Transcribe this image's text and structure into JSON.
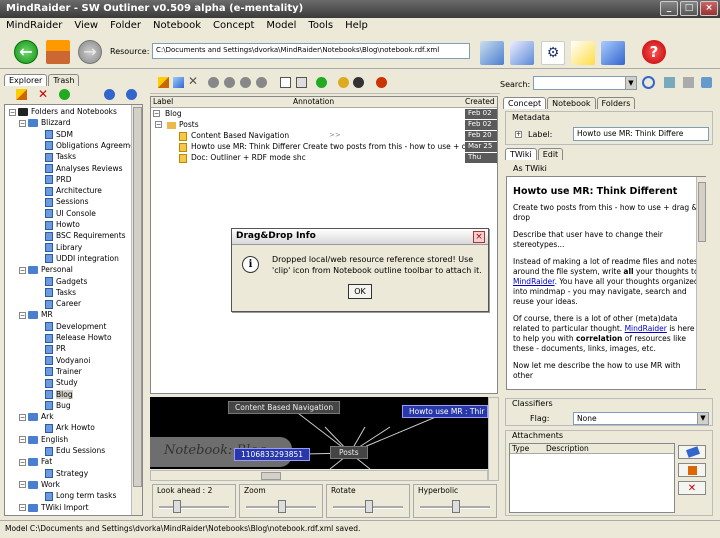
{
  "window": {
    "title": "MindRaider - SW Outliner v0.509 alpha (e-mentality)"
  },
  "menu": [
    "MindRaider",
    "View",
    "Folder",
    "Notebook",
    "Concept",
    "Model",
    "Tools",
    "Help"
  ],
  "resource": {
    "label": "Resource:",
    "value": "C:\\Documents and Settings\\dvorka\\MindRaider\\Notebooks\\Blog\\notebook.rdf.xml"
  },
  "explorer": {
    "tabs": [
      "Explorer",
      "Trash"
    ],
    "tree": [
      {
        "label": "Folders and Notebooks",
        "level": 0,
        "kind": "root"
      },
      {
        "label": "Blizzard",
        "level": 1,
        "kind": "folder"
      },
      {
        "label": "SDM",
        "level": 2,
        "kind": "nb"
      },
      {
        "label": "Obligations Agreement",
        "level": 2,
        "kind": "nb"
      },
      {
        "label": "Tasks",
        "level": 2,
        "kind": "nb"
      },
      {
        "label": "Analyses Reviews",
        "level": 2,
        "kind": "nb"
      },
      {
        "label": "PRD",
        "level": 2,
        "kind": "nb"
      },
      {
        "label": "Architecture",
        "level": 2,
        "kind": "nb"
      },
      {
        "label": "Sessions",
        "level": 2,
        "kind": "nb"
      },
      {
        "label": "UI Console",
        "level": 2,
        "kind": "nb"
      },
      {
        "label": "Howto",
        "level": 2,
        "kind": "nb"
      },
      {
        "label": "BSC Requirements",
        "level": 2,
        "kind": "nb"
      },
      {
        "label": "Library",
        "level": 2,
        "kind": "nb"
      },
      {
        "label": "UDDI integration",
        "level": 2,
        "kind": "nb"
      },
      {
        "label": "Personal",
        "level": 1,
        "kind": "folder"
      },
      {
        "label": "Gadgets",
        "level": 2,
        "kind": "nb"
      },
      {
        "label": "Tasks",
        "level": 2,
        "kind": "nb"
      },
      {
        "label": "Career",
        "level": 2,
        "kind": "nb"
      },
      {
        "label": "MR",
        "level": 1,
        "kind": "folder"
      },
      {
        "label": "Development",
        "level": 2,
        "kind": "nb"
      },
      {
        "label": "Release Howto",
        "level": 2,
        "kind": "nb"
      },
      {
        "label": "PR",
        "level": 2,
        "kind": "nb"
      },
      {
        "label": "Vodyanoi",
        "level": 2,
        "kind": "nb"
      },
      {
        "label": "Trainer",
        "level": 2,
        "kind": "nb"
      },
      {
        "label": "Study",
        "level": 2,
        "kind": "nb"
      },
      {
        "label": "Blog",
        "level": 2,
        "kind": "nb",
        "selected": true
      },
      {
        "label": "Bug",
        "level": 2,
        "kind": "nb"
      },
      {
        "label": "Ark",
        "level": 1,
        "kind": "folder"
      },
      {
        "label": "Ark Howto",
        "level": 2,
        "kind": "nb"
      },
      {
        "label": "English",
        "level": 1,
        "kind": "folder"
      },
      {
        "label": "Edu Sessions",
        "level": 2,
        "kind": "nb"
      },
      {
        "label": "Fat",
        "level": 1,
        "kind": "folder"
      },
      {
        "label": "Strategy",
        "level": 2,
        "kind": "nb"
      },
      {
        "label": "Work",
        "level": 1,
        "kind": "folder"
      },
      {
        "label": "Long term tasks",
        "level": 2,
        "kind": "nb"
      },
      {
        "label": "TWiki Import",
        "level": 1,
        "kind": "folder"
      }
    ]
  },
  "outline": {
    "columns": [
      "Label",
      "Annotation",
      "Created"
    ],
    "rows": [
      {
        "label": "Blog",
        "level": 0,
        "annotation": "",
        "date": "Feb 02"
      },
      {
        "label": "Posts",
        "level": 1,
        "annotation": "",
        "date": "Feb 02"
      },
      {
        "label": "Content Based Navigation",
        "level": 2,
        "annotation": ">>",
        "date": "Feb 20"
      },
      {
        "label": "Howto use MR: Think Differer Create two posts from this - how to use + drag",
        "level": 2,
        "annotation": "",
        "date": "Mar 25"
      },
      {
        "label": "Doc: Outliner + RDF mode shc",
        "level": 2,
        "annotation": "",
        "date": "Thu"
      }
    ]
  },
  "dialog": {
    "title": "Drag&Drop Info",
    "message_line1": "Dropped local/web resource reference stored! Use",
    "message_line2": "'clip' icon from Notebook outline toolbar to attach it.",
    "ok": "OK"
  },
  "graph": {
    "nodes": [
      "Content Based Navigation",
      "Howto use MR : Thir",
      "Posts",
      "Notebook: Blog",
      "1106833293851"
    ]
  },
  "sliders": [
    {
      "label": "Look ahead : 2",
      "level": 0.2
    },
    {
      "label": "Zoom",
      "level": 0.5
    },
    {
      "label": "Rotate",
      "level": 0.5
    },
    {
      "label": "Hyperbolic",
      "level": 0.5
    }
  ],
  "right": {
    "search_label": "Search:",
    "tabs": [
      "Concept",
      "Notebook",
      "Folders"
    ],
    "metadata_title": "Metadata",
    "label_field": "Label:",
    "label_value": "Howto use MR: Think Differe",
    "content_tabs": [
      "TWiki",
      "Edit"
    ],
    "as_twiki": "As TWiki",
    "heading": "Howto use MR: Think Different",
    "para1": "Create two posts from this - how to use + drag & drop",
    "para2": "Describe that user have to change their stereotypes...",
    "para3a": "Instead of making a lot of readme files and notes around the file system, write ",
    "para3b": "all",
    "para3c": " your thoughts to ",
    "para3d": "MindRaider",
    "para3e": ". You have all your thoughts organized into mindmap - you may navigate, search and reuse your ideas.",
    "para4a": "Of course, there is a lot of other (meta)data related to particular thought. ",
    "para4b": "MindRaider",
    "para4c": " is here to help you with ",
    "para4d": "correlation",
    "para4e": " of resources like these - documents, links, images, etc.",
    "para5": "Now let me describe the how to use MR with other",
    "classifiers_title": "Classifiers",
    "flag_label": "Flag:",
    "flag_value": "None",
    "attachments_title": "Attachments",
    "att_cols": [
      "Type",
      "Description"
    ]
  },
  "status": "Model C:\\Documents and Settings\\dvorka\\MindRaider\\Notebooks\\Blog\\notebook.rdf.xml saved."
}
